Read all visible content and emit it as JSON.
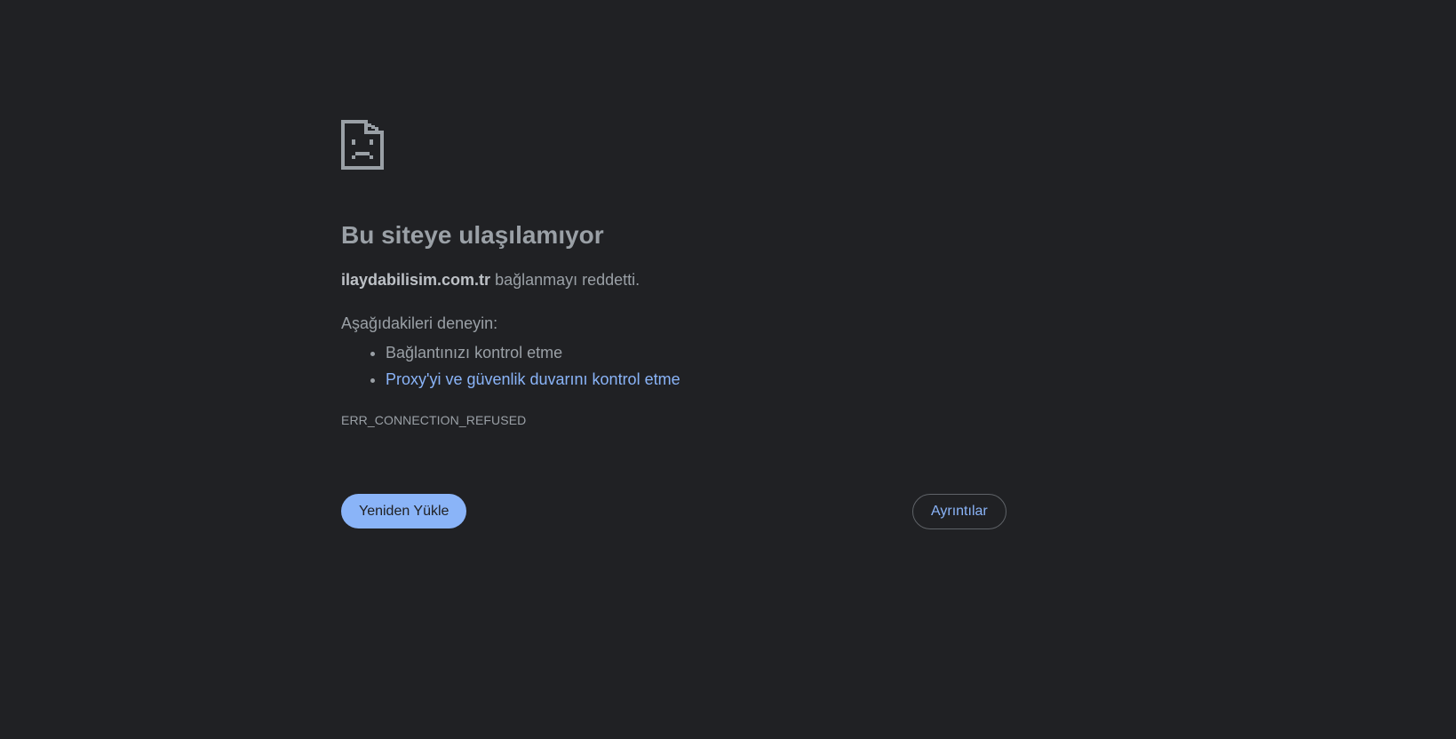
{
  "error": {
    "icon": "sad-document-icon",
    "title": "Bu siteye ulaşılamıyor",
    "host": "ilaydabilisim.com.tr",
    "summary_suffix": " bağlanmayı reddetti.",
    "suggestions_heading": "Aşağıdakileri deneyin:",
    "suggestions": [
      {
        "label": "Bağlantınızı kontrol etme",
        "is_link": false
      },
      {
        "label": "Proxy'yi ve güvenlik duvarını kontrol etme",
        "is_link": true
      }
    ],
    "code": "ERR_CONNECTION_REFUSED"
  },
  "buttons": {
    "reload_label": "Yeniden Yükle",
    "details_label": "Ayrıntılar"
  },
  "colors": {
    "background": "#202124",
    "text": "#9aa0a6",
    "link": "#8ab4f8",
    "primary_button": "#8ab4f8"
  }
}
